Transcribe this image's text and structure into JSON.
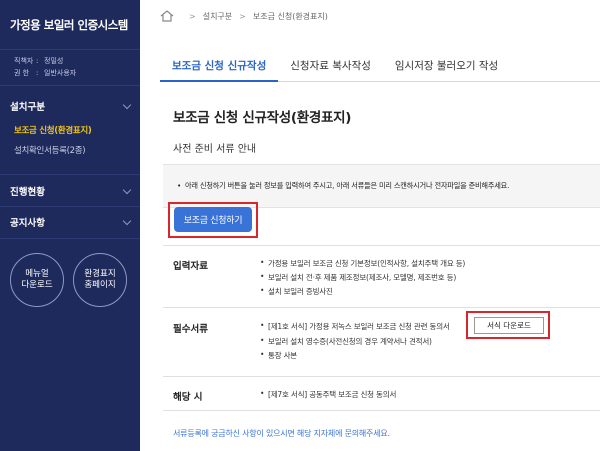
{
  "app": {
    "title": "가정용 보일러 인증시스템"
  },
  "user": {
    "org_label": "직책자",
    "org_value": "정밀성",
    "role_label": "권  한",
    "role_value": "일반사용자"
  },
  "sidebar": {
    "section_install": "설치구분",
    "install_items": [
      "보조금 신청(환경표지)",
      "설치확인서등록(2종)"
    ],
    "section_progress": "진행현황",
    "section_notice": "공지사항",
    "manual_button": [
      "메뉴얼",
      "다운로드"
    ],
    "eco_button": [
      "환경표지",
      "홈페이지"
    ]
  },
  "breadcrumb": {
    "items": [
      "설치구분",
      "보조금 신청(환경표지)"
    ]
  },
  "tabs": [
    "보조금 신청 신규작성",
    "신청자료 복사작성",
    "임시저장 불러오기 작성"
  ],
  "main": {
    "title": "보조금 신청 신규작성(환경표지)",
    "subtitle": "사전 준비 서류 안내",
    "notice": "아래 신청하기 버튼을 눌러 정보를 입력하여 주시고, 아래 서류들은 미리 스캔하시거나 전자파일을 준비해주세요.",
    "apply_button": "보조금 신청하기",
    "sections": {
      "input": {
        "label": "입력자료",
        "items": [
          "가정용 보일러 보조금 신청 기본정보(인적사항, 설치주택 개요 등)",
          "보일러 설치 전·후 제품 제조정보(제조사, 모델명, 제조번호 등)",
          "설치 보일러 증빙사진"
        ]
      },
      "required": {
        "label": "필수서류",
        "items": [
          "[제1호 서식] 가정용 저녹스 보일러 보조금 신청 관련 동의서",
          "보일러 설치 영수증(사전신청의 경우 계약서나 견적서)",
          "통장 사본"
        ],
        "download_button": "서식 다운로드"
      },
      "applicable": {
        "label": "해당 시",
        "items": [
          "[제7호 서식] 공동주택 보조금 신청 동의서"
        ]
      }
    },
    "footer": "서류등록에 궁금하신 사항이 있으시면 해당 지자체에 문의해주세요."
  },
  "colors": {
    "sidebar_bg": "#1f2a5c",
    "accent": "#2a64c8",
    "active_menu": "#f0c419",
    "highlight": "#d9262d"
  }
}
